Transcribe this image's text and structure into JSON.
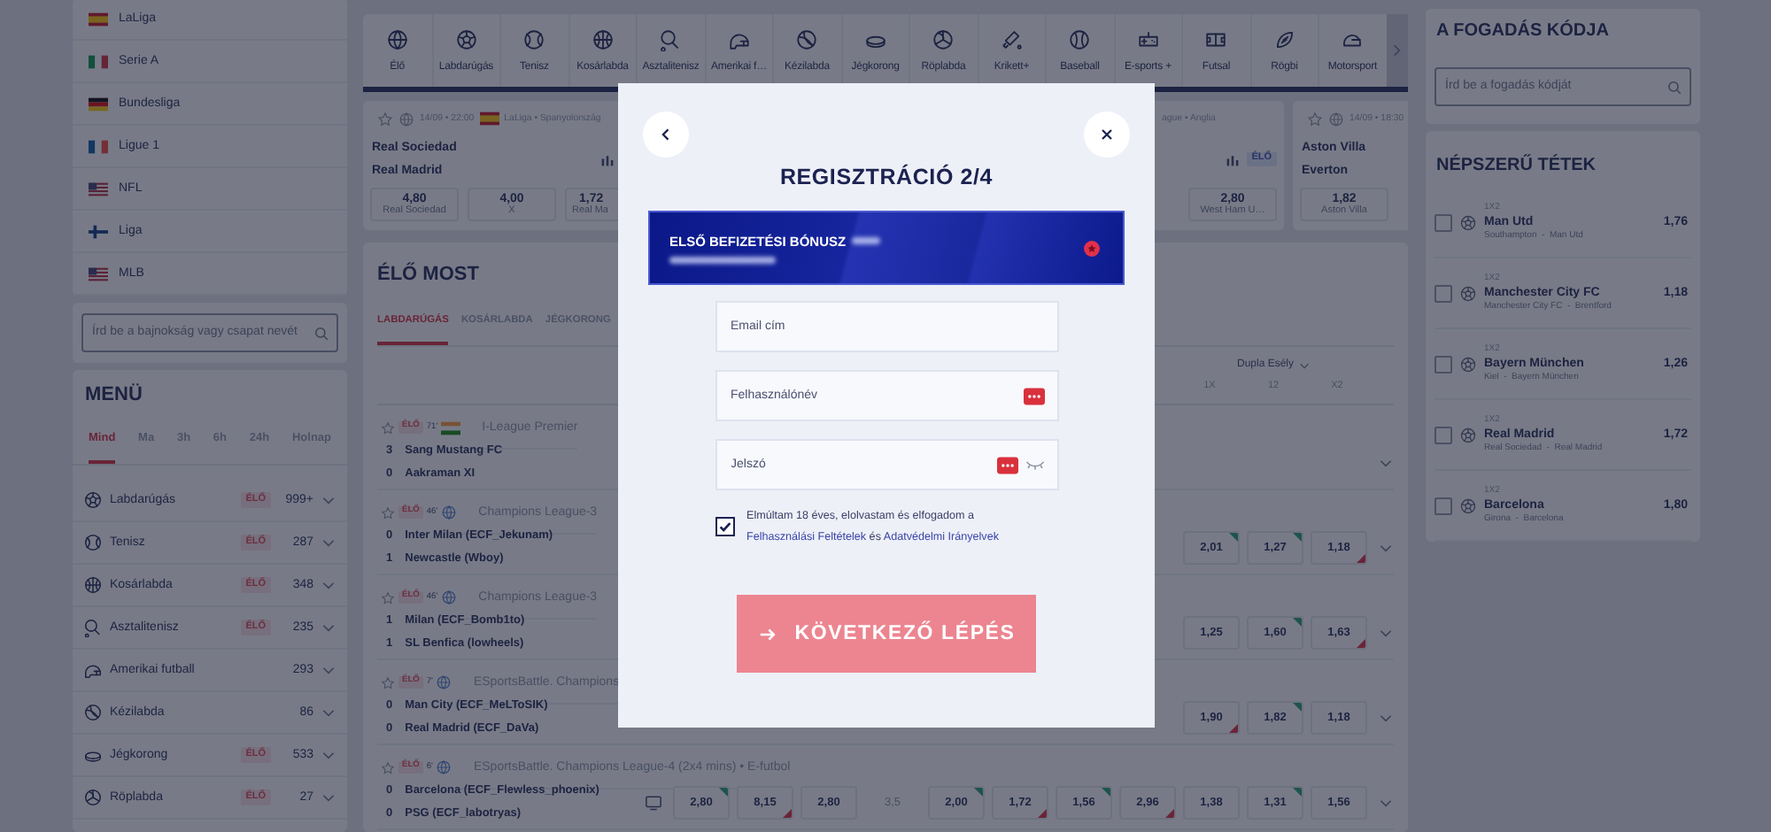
{
  "sidebar": {
    "leagues": [
      {
        "name": "LaLiga"
      },
      {
        "name": "Serie A"
      },
      {
        "name": "Bundesliga"
      },
      {
        "name": "Ligue 1"
      },
      {
        "name": "NFL"
      },
      {
        "name": "Liga"
      },
      {
        "name": "MLB"
      }
    ],
    "search": {
      "placeholder": "Írd be a bajnokság vagy csapat nevét"
    },
    "menu": {
      "title": "MENÜ",
      "tabs": [
        {
          "label": "Mind",
          "selected": true
        },
        {
          "label": "Ma",
          "selected": false
        },
        {
          "label": "3h",
          "selected": false
        },
        {
          "label": "6h",
          "selected": false
        },
        {
          "label": "24h",
          "selected": false
        },
        {
          "label": "Holnap",
          "selected": false
        }
      ],
      "sports": [
        {
          "name": "Labdarúgás",
          "live_badge": "ÉLŐ",
          "count": "999+"
        },
        {
          "name": "Tenisz",
          "live_badge": "ÉLŐ",
          "count": "287"
        },
        {
          "name": "Kosárlabda",
          "live_badge": "ÉLŐ",
          "count": "348"
        },
        {
          "name": "Asztalitenisz",
          "live_badge": "ÉLŐ",
          "count": "235"
        },
        {
          "name": "Amerikai futball",
          "count": "293"
        },
        {
          "name": "Kézilabda",
          "count": "86"
        },
        {
          "name": "Jégkorong",
          "live_badge": "ÉLŐ",
          "count": "533"
        },
        {
          "name": "Röplabda",
          "live_badge": "ÉLŐ",
          "count": "27"
        }
      ]
    }
  },
  "sports_bar": {
    "items": [
      {
        "label": "Élő"
      },
      {
        "label": "Labdarúgás"
      },
      {
        "label": "Tenisz"
      },
      {
        "label": "Kosárlabda"
      },
      {
        "label": "Asztalitenisz"
      },
      {
        "label": "Amerikai f…"
      },
      {
        "label": "Kézilabda"
      },
      {
        "label": "Jégkorong"
      },
      {
        "label": "Röplabda"
      },
      {
        "label": "Krikett+"
      },
      {
        "label": "Baseball"
      },
      {
        "label": "E-sports +"
      },
      {
        "label": "Futsal"
      },
      {
        "label": "Rögbi"
      },
      {
        "label": "Motorsport"
      }
    ]
  },
  "featured_matches": [
    {
      "kind": "full",
      "date": "14/09 • 22:00",
      "league": "LaLiga • Spanyolország",
      "home": "Real Sociedad",
      "away": "Real Madrid",
      "odds": [
        {
          "value": "4,80",
          "label": "Real Sociedad"
        },
        {
          "value": "4,00",
          "label": "X"
        },
        {
          "value": "1,72",
          "label": "Real Ma"
        }
      ]
    },
    {
      "kind": "covered",
      "league": "ague • Anglia",
      "live_badge": "ÉLŐ",
      "odds": [
        {
          "value": "2,80",
          "label": "West Ham U…"
        }
      ]
    },
    {
      "kind": "clipped",
      "date": "14/09 • 18:30",
      "home": "Aston Villa",
      "away": "Everton",
      "odds": [
        {
          "value": "1,82",
          "label": "Aston Villa"
        }
      ]
    }
  ],
  "live": {
    "title": "ÉLŐ MOST",
    "tabs": [
      {
        "label": "LABDARÚGÁS",
        "selected": true
      },
      {
        "label": "KOSÁRLABDA",
        "selected": false
      },
      {
        "label": "JÉGKORONG",
        "selected": false
      }
    ],
    "market": {
      "label": "Dupla Esély",
      "columns": [
        "1X",
        "12",
        "X2"
      ]
    },
    "matches": [
      {
        "live_badge": "ÉLŐ",
        "minute": "71'",
        "league": "I-League Premier",
        "teams": [
          {
            "score": "3",
            "name": "Sang Mustang FC"
          },
          {
            "score": "0",
            "name": "Aakraman XI"
          }
        ]
      },
      {
        "live_badge": "ÉLŐ",
        "minute": "46'",
        "league": "Champions League-3",
        "teams": [
          {
            "score": "0",
            "name": "Inter Milan (ECF_Jekunam)"
          },
          {
            "score": "1",
            "name": "Newcastle (Wboy)"
          }
        ],
        "odds": [
          {
            "kind": "box",
            "value": "2,01",
            "up": true,
            "down": false
          },
          {
            "kind": "box",
            "value": "1,27",
            "up": true,
            "down": false
          },
          {
            "kind": "box",
            "value": "1,18",
            "up": false,
            "down": true
          }
        ]
      },
      {
        "live_badge": "ÉLŐ",
        "minute": "46'",
        "league": "Champions League-3",
        "teams": [
          {
            "score": "1",
            "name": "Milan (ECF_Bomb1to)"
          },
          {
            "score": "1",
            "name": "SL Benfica (lowheels)"
          }
        ],
        "odds": [
          {
            "kind": "box",
            "value": "1,25",
            "up": false,
            "down": false
          },
          {
            "kind": "box",
            "value": "1,60",
            "up": true,
            "down": false
          },
          {
            "kind": "box",
            "value": "1,63",
            "up": false,
            "down": true
          }
        ]
      },
      {
        "live_badge": "ÉLŐ",
        "minute": "7'",
        "league": "ESportsBattle. Champions",
        "teams": [
          {
            "score": "0",
            "name": "Man City (ECF_MeLToSIK)"
          },
          {
            "score": "0",
            "name": "Real Madrid (ECF_DaVa)"
          }
        ],
        "odds": [
          {
            "kind": "box",
            "value": "1,90",
            "up": false,
            "down": true
          },
          {
            "kind": "box",
            "value": "1,82",
            "up": true,
            "down": false
          },
          {
            "kind": "box",
            "value": "1,18",
            "up": false,
            "down": false
          }
        ]
      },
      {
        "live_badge": "ÉLŐ",
        "minute": "6'",
        "league": "ESportsBattle. Champions League-4 (2x4 mins) • E-futbol",
        "tv": true,
        "teams": [
          {
            "score": "0",
            "name": "Barcelona (ECF_Flewless_phoenix)"
          },
          {
            "score": "0",
            "name": "PSG (ECF_labotryas)"
          }
        ],
        "odds": [
          {
            "kind": "box",
            "value": "2,80",
            "up": true,
            "down": false
          },
          {
            "kind": "box",
            "value": "8,15",
            "up": false,
            "down": true
          },
          {
            "kind": "box",
            "value": "2,80",
            "up": false,
            "down": false
          },
          {
            "kind": "line",
            "value": "3,5"
          },
          {
            "kind": "box",
            "value": "2,00",
            "up": true,
            "down": false
          },
          {
            "kind": "box",
            "value": "1,72",
            "up": false,
            "down": true
          },
          {
            "kind": "box",
            "value": "1,56",
            "up": true,
            "down": false
          },
          {
            "kind": "box",
            "value": "2,96",
            "up": false,
            "down": true
          },
          {
            "kind": "box",
            "value": "1,38",
            "up": false,
            "down": false
          },
          {
            "kind": "box",
            "value": "1,31",
            "up": true,
            "down": false
          },
          {
            "kind": "box",
            "value": "1,56",
            "up": false,
            "down": false
          }
        ]
      }
    ]
  },
  "bet_code": {
    "title": "A FOGADÁS KÓDJA",
    "placeholder": "Írd be a fogadás kódját"
  },
  "popular": {
    "title": "NÉPSZERŰ TÉTEK",
    "items": [
      {
        "market": "1X2",
        "selection": "Man Utd",
        "match": "Southampton  -  Man Utd",
        "odds": "1,76",
        "checked": false
      },
      {
        "market": "1X2",
        "selection": "Manchester City FC",
        "match": "Manchester City FC  -  Brentford",
        "odds": "1,18",
        "checked": false
      },
      {
        "market": "1X2",
        "selection": "Bayern München",
        "match": "Kiel  -  Bayern München",
        "odds": "1,26",
        "checked": false
      },
      {
        "market": "1X2",
        "selection": "Real Madrid",
        "match": "Real Sociedad  -  Real Madrid",
        "odds": "1,72",
        "checked": false
      },
      {
        "market": "1X2",
        "selection": "Barcelona",
        "match": "Girona  -  Barcelona",
        "odds": "1,80",
        "checked": false
      }
    ]
  },
  "modal": {
    "title": "REGISZTRÁCIÓ 2/4",
    "bonus": {
      "title": "ELSŐ BEFIZETÉSI BÓNUSZ"
    },
    "fields": [
      {
        "kind": "plain",
        "placeholder": "Email cím"
      },
      {
        "kind": "autofill",
        "placeholder": "Felhasználónév"
      },
      {
        "kind": "password",
        "placeholder": "Jelszó"
      }
    ],
    "consent": {
      "checked": true,
      "text": "Elmúltam 18 éves, elolvastam és elfogadom a",
      "link1": "Felhasználási Feltételek",
      "joiner": "és",
      "link2": "Adatvédelmi Irányelvek"
    },
    "next_button": {
      "label": "KÖVETKEZŐ LÉPÉS",
      "disabled": true
    }
  }
}
